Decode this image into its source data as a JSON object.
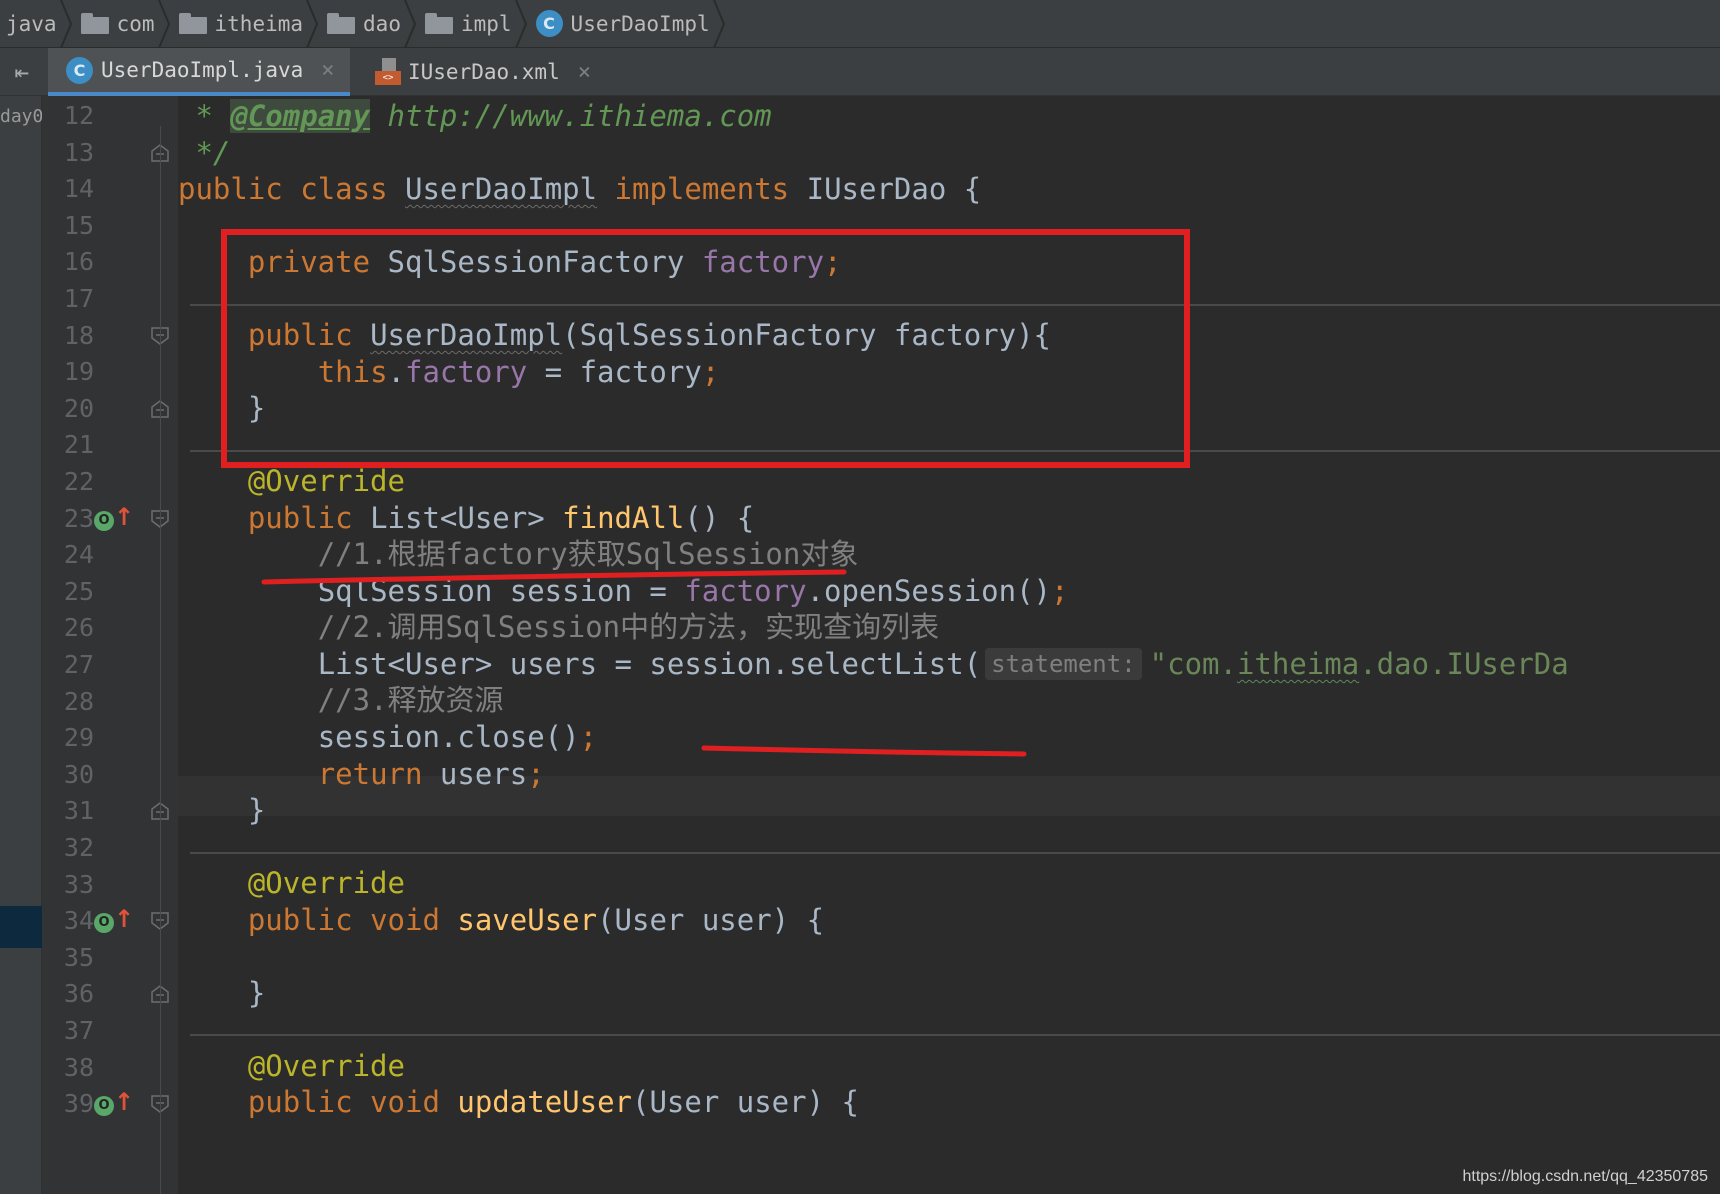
{
  "breadcrumb": {
    "items": [
      {
        "label": "java",
        "icon": "none"
      },
      {
        "label": "com",
        "icon": "folder-icon"
      },
      {
        "label": "itheima",
        "icon": "folder-icon"
      },
      {
        "label": "dao",
        "icon": "folder-icon"
      },
      {
        "label": "impl",
        "icon": "folder-icon"
      },
      {
        "label": "UserDaoImpl",
        "icon": "class-icon"
      }
    ],
    "class_icon_letter": "C"
  },
  "tabs": [
    {
      "label": "UserDaoImpl.java",
      "icon": "class-icon",
      "active": true,
      "close": "×"
    },
    {
      "label": "IUserDao.xml",
      "icon": "xml-file-icon",
      "active": false,
      "close": "×"
    }
  ],
  "tab_side_icon": "⇤",
  "project_panel_label": "day0",
  "editor": {
    "line_numbers": [
      "12",
      "13",
      "14",
      "15",
      "16",
      "17",
      "18",
      "19",
      "20",
      "21",
      "22",
      "23",
      "24",
      "25",
      "26",
      "27",
      "28",
      "29",
      "30",
      "31",
      "32",
      "33",
      "34",
      "35",
      "36",
      "37",
      "38",
      "39"
    ],
    "current_line": "29",
    "override_icon_letter": "O",
    "override_icon_arrow": "↑",
    "lines": {
      "l12": {
        "star": " * ",
        "tag": "@Company",
        "url": " http://www.ithiema.com"
      },
      "l13": {
        "text": " */"
      },
      "l14": {
        "kw1": "public",
        "kw2": "class",
        "name": "UserDaoImpl",
        "kw3": "implements",
        "iface": "IUserDao",
        "brace": "{"
      },
      "l16": {
        "kw": "private",
        "type": "SqlSessionFactory",
        "field": "factory",
        "semi": ";"
      },
      "l18": {
        "kw": "public",
        "name": "UserDaoImpl",
        "params": "(SqlSessionFactory factory){"
      },
      "l19": {
        "kw": "this",
        "dot": ".",
        "field": "factory",
        "rest": " = factory",
        "semi": ";"
      },
      "l20": {
        "text": "}"
      },
      "l22": {
        "ann": "@Override"
      },
      "l23": {
        "kw": "public",
        "type": "List<User>",
        "method": "findAll",
        "rest": "() {"
      },
      "l24": {
        "comment": "//1.根据factory获取SqlSession对象"
      },
      "l25": {
        "type": "SqlSession session = ",
        "field": "factory",
        "rest": ".openSession()",
        "semi": ";"
      },
      "l26": {
        "comment": "//2.调用SqlSession中的方法，实现查询列表"
      },
      "l27": {
        "pre": "List<User> users = session.selectList(",
        "hint": "statement:",
        "str1": "\"com.",
        "str2": "itheima",
        "str3": ".dao.IUserDa"
      },
      "l28": {
        "comment": "//3.释放资源"
      },
      "l29": {
        "text": "session.close()",
        "semi": ";"
      },
      "l30": {
        "kw": "return",
        "rest": " users",
        "semi": ";"
      },
      "l31": {
        "text": "}"
      },
      "l33": {
        "ann": "@Override"
      },
      "l34": {
        "kw1": "public",
        "kw2": "void",
        "method": "saveUser",
        "rest": "(User user) {"
      },
      "l36": {
        "text": "}"
      },
      "l38": {
        "ann": "@Override"
      },
      "l39": {
        "kw1": "public",
        "kw2": "void",
        "method": "updateUser",
        "rest": "(User user) {"
      }
    }
  },
  "colors": {
    "keyword": "#cc7832",
    "field": "#9876aa",
    "method": "#ffc66d",
    "annotation": "#bbb529",
    "comment": "#808080",
    "string": "#6a8759",
    "highlight_box": "#e02020"
  },
  "watermark": "https://blog.csdn.net/qq_42350785"
}
